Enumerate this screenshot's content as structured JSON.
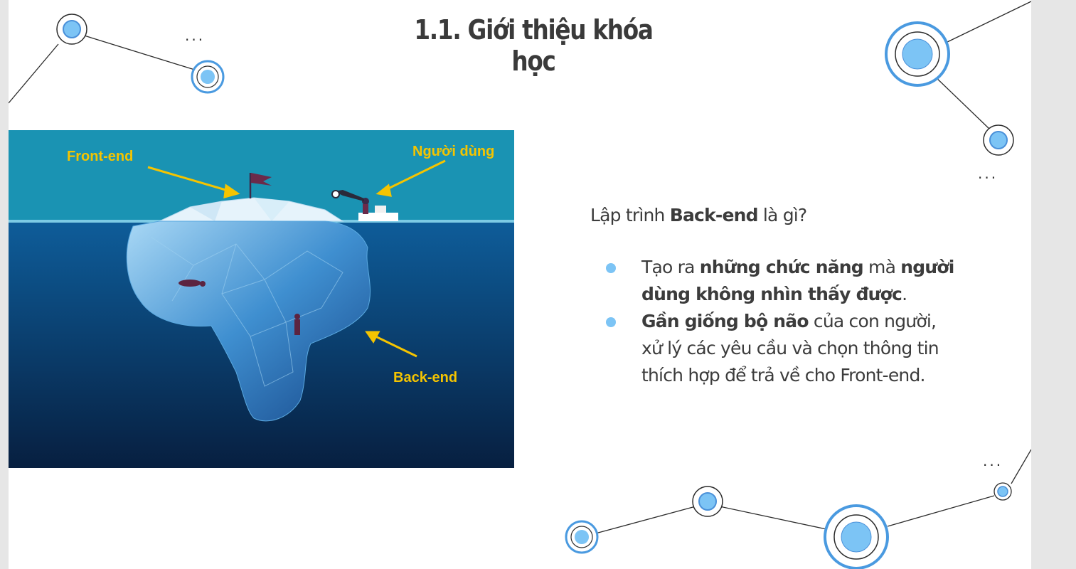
{
  "slide": {
    "title": "1.1. Giới thiệu khóa học",
    "dots": "..."
  },
  "image": {
    "labels": {
      "front_end": "Front-end",
      "user": "Người dùng",
      "back_end": "Back-end"
    },
    "colors": {
      "sky": "#1a93b3",
      "deep_sea": "#0a2f5c",
      "label": "#f5c400"
    }
  },
  "content": {
    "question_prefix": "Lập trình ",
    "question_bold": "Back-end",
    "question_suffix": " là gì?",
    "bullets": [
      {
        "t1": "Tạo ra ",
        "b1": "những chức năng",
        "t2": " mà ",
        "b2": "người dùng không nhìn thấy được",
        "t3": "."
      },
      {
        "b1": "Gần giống bộ não",
        "t1": " của con người, xử lý các yêu cầu và chọn thông tin thích hợp để trả về cho Front-end."
      }
    ]
  },
  "colors": {
    "accent_blue": "#7cc4f5",
    "ring_blue": "#4fa6e8",
    "text": "#3c3c3c"
  }
}
